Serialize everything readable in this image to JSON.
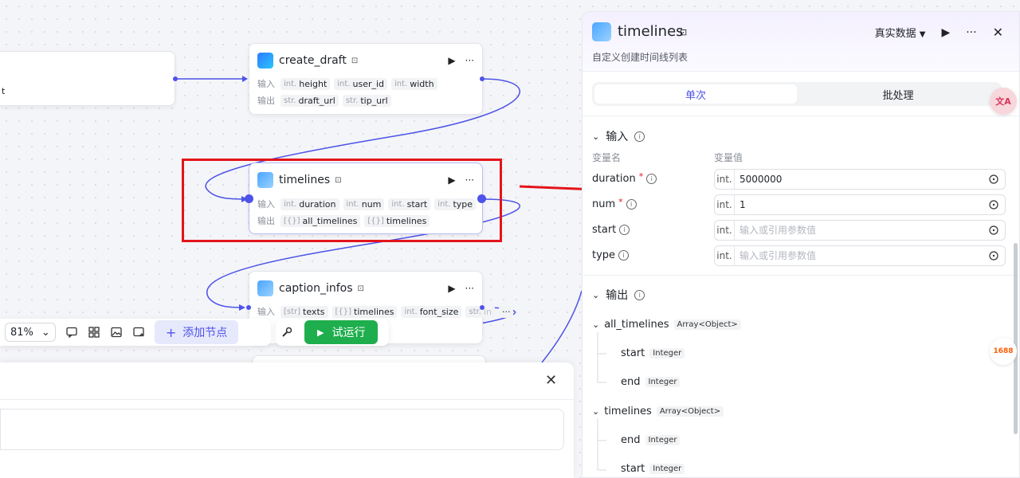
{
  "canvas": {
    "left_node": {
      "partial_text": "t"
    },
    "nodes": {
      "create_draft": {
        "title": "create_draft",
        "input_label": "输入",
        "output_label": "输出",
        "inputs": [
          {
            "type": "int.",
            "name": "height"
          },
          {
            "type": "int.",
            "name": "user_id"
          },
          {
            "type": "int.",
            "name": "width"
          }
        ],
        "outputs": [
          {
            "type": "str.",
            "name": "draft_url"
          },
          {
            "type": "str.",
            "name": "tip_url"
          }
        ]
      },
      "timelines": {
        "title": "timelines",
        "input_label": "输入",
        "output_label": "输出",
        "inputs": [
          {
            "type": "int.",
            "name": "duration"
          },
          {
            "type": "int.",
            "name": "num"
          },
          {
            "type": "int.",
            "name": "start"
          },
          {
            "type": "int.",
            "name": "type"
          }
        ],
        "outputs": [
          {
            "type": "[{}]",
            "name": "all_timelines"
          },
          {
            "type": "[{}]",
            "name": "timelines"
          }
        ]
      },
      "caption_infos": {
        "title": "caption_infos",
        "input_label": "输入",
        "inputs": [
          {
            "type": "[str]",
            "name": "texts"
          },
          {
            "type": "[{}]",
            "name": "timelines"
          },
          {
            "type": "int.",
            "name": "font_size"
          },
          {
            "type": "str.",
            "name": "in"
          }
        ],
        "more": "···"
      }
    },
    "toolbar": {
      "zoom": "81%",
      "add_node": "添加节点",
      "run": "试运行"
    }
  },
  "panel": {
    "title": "timelines",
    "subtitle": "自定义创建时间线列表",
    "data_mode": "真实数据",
    "tabs": {
      "single": "单次",
      "batch": "批处理"
    },
    "input_section": {
      "title": "输入",
      "col_name": "变量名",
      "col_value": "变量值",
      "fields": [
        {
          "name": "duration",
          "required": "*",
          "type": "int.",
          "value": "5000000",
          "placeholder": ""
        },
        {
          "name": "num",
          "required": "*",
          "type": "int.",
          "value": "1",
          "placeholder": ""
        },
        {
          "name": "start",
          "required": "",
          "type": "int.",
          "value": "",
          "placeholder": "输入或引用参数值"
        },
        {
          "name": "type",
          "required": "",
          "type": "int.",
          "value": "",
          "placeholder": "输入或引用参数值"
        }
      ]
    },
    "output_section": {
      "title": "输出",
      "items": [
        {
          "name": "all_timelines",
          "type": "Array<Object>",
          "children": [
            {
              "name": "start",
              "type": "Integer"
            },
            {
              "name": "end",
              "type": "Integer"
            }
          ]
        },
        {
          "name": "timelines",
          "type": "Array<Object>",
          "children": [
            {
              "name": "end",
              "type": "Integer"
            },
            {
              "name": "start",
              "type": "Integer"
            }
          ]
        }
      ]
    }
  },
  "side_buttons": {
    "translate": "文A",
    "ali": "1688"
  }
}
